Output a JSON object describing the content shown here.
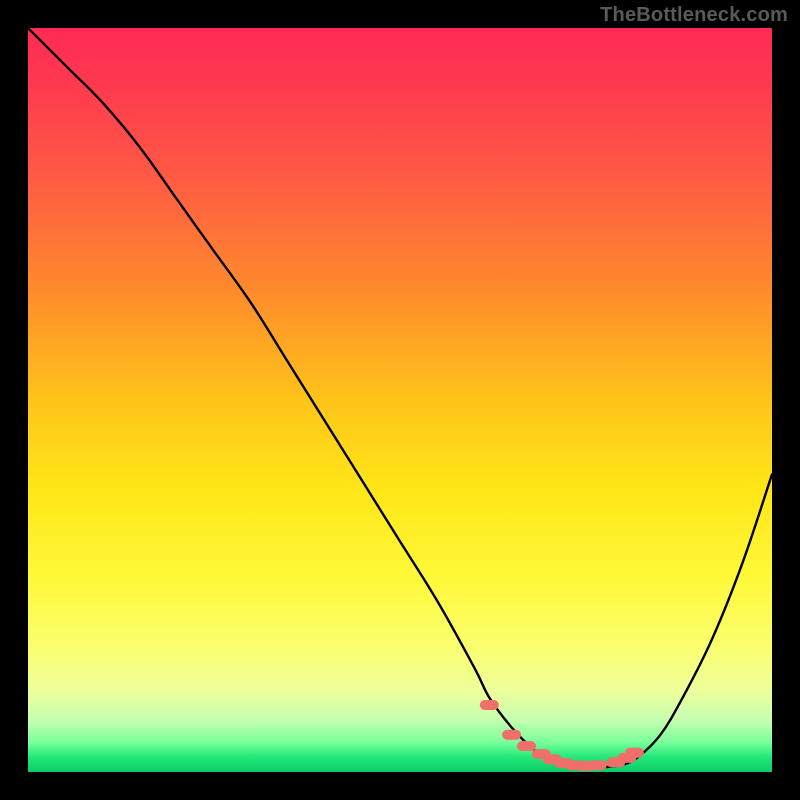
{
  "watermark": "TheBottleneck.com",
  "colors": {
    "frame": "#000000",
    "curve": "#000000",
    "dots": "#ef6f6a"
  },
  "chart_data": {
    "type": "line",
    "title": "",
    "xlabel": "",
    "ylabel": "",
    "xlim": [
      0,
      100
    ],
    "ylim": [
      0,
      100
    ],
    "grid": false,
    "legend": false,
    "series": [
      {
        "name": "bottleneck-curve",
        "x": [
          0,
          5,
          10,
          15,
          20,
          25,
          30,
          35,
          40,
          45,
          50,
          55,
          60,
          62,
          65,
          68,
          70,
          72,
          74,
          76,
          78,
          80,
          82,
          85,
          88,
          92,
          96,
          100
        ],
        "y": [
          100,
          95,
          90,
          84,
          77,
          70,
          63,
          55,
          47,
          39,
          31,
          23,
          14,
          10,
          6,
          3,
          2,
          1,
          0.6,
          0.5,
          0.7,
          1,
          2,
          5,
          10,
          18,
          28,
          40
        ]
      }
    ],
    "highlight_dots": {
      "name": "optimal-range-dots",
      "x": [
        62,
        65,
        67,
        69,
        70.5,
        72,
        73.5,
        75,
        76.5,
        79,
        80.5,
        81.5
      ],
      "y": [
        9,
        5,
        3.5,
        2.4,
        1.7,
        1.2,
        0.9,
        0.8,
        0.9,
        1.3,
        1.9,
        2.6
      ]
    }
  }
}
